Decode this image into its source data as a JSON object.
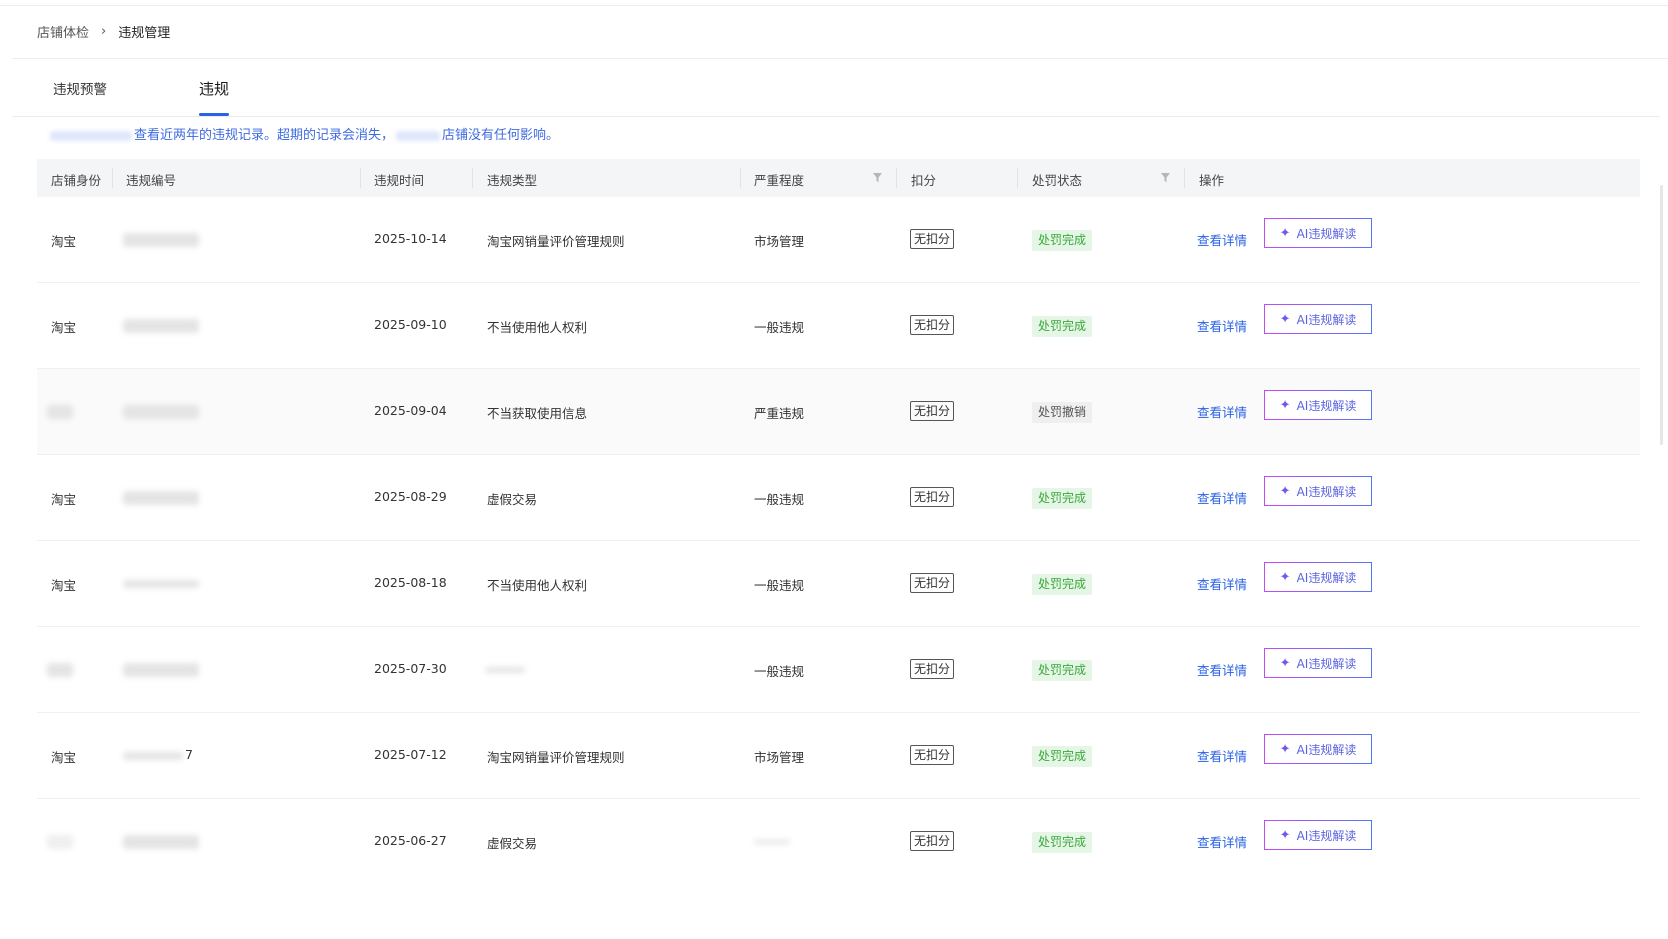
{
  "breadcrumb": {
    "parent": "店铺体检",
    "separator": "›",
    "current": "违规管理"
  },
  "tabs": [
    {
      "label": "违规预警",
      "active": false
    },
    {
      "label": "违规",
      "active": true
    }
  ],
  "notice": {
    "text_1": "查看近两年的违规记录。超期的记录会消失，",
    "text_2": "店铺没有任何影响。"
  },
  "columns": {
    "shop_identity": "店铺身份",
    "violation_id": "违规编号",
    "violation_time": "违规时间",
    "violation_type": "违规类型",
    "severity": "严重程度",
    "deduction": "扣分",
    "penalty_status": "处罚状态",
    "actions": "操作"
  },
  "rows": [
    {
      "shop": "淘宝",
      "id_suffix": "",
      "date": "2025-10-14",
      "type": "淘宝网销量评价管理规则",
      "severity": "市场管理",
      "deduction": "无扣分",
      "status": "处罚完成",
      "status_kind": "done",
      "detail": "查看详情",
      "ai": "AI违规解读"
    },
    {
      "shop": "淘宝",
      "id_suffix": "",
      "date": "2025-09-10",
      "type": "不当使用他人权利",
      "severity": "一般违规",
      "deduction": "无扣分",
      "status": "处罚完成",
      "status_kind": "done",
      "detail": "查看详情",
      "ai": "AI违规解读"
    },
    {
      "shop": "",
      "id_suffix": "",
      "date": "2025-09-04",
      "type": "不当获取使用信息",
      "severity": "严重违规",
      "deduction": "无扣分",
      "status": "处罚撤销",
      "status_kind": "revoked",
      "detail": "查看详情",
      "ai": "AI违规解读"
    },
    {
      "shop": "淘宝",
      "id_suffix": "",
      "date": "2025-08-29",
      "type": "虚假交易",
      "severity": "一般违规",
      "deduction": "无扣分",
      "status": "处罚完成",
      "status_kind": "done",
      "detail": "查看详情",
      "ai": "AI违规解读"
    },
    {
      "shop": "淘宝",
      "id_suffix": "",
      "date": "2025-08-18",
      "type": "不当使用他人权利",
      "severity": "一般违规",
      "deduction": "无扣分",
      "status": "处罚完成",
      "status_kind": "done",
      "detail": "查看详情",
      "ai": "AI违规解读"
    },
    {
      "shop": "",
      "id_suffix": "",
      "date": "2025-07-30",
      "type": "",
      "severity": "一般违规",
      "deduction": "无扣分",
      "status": "处罚完成",
      "status_kind": "done",
      "detail": "查看详情",
      "ai": "AI违规解读"
    },
    {
      "shop": "淘宝",
      "id_suffix": "7",
      "date": "2025-07-12",
      "type": "淘宝网销量评价管理规则",
      "severity": "市场管理",
      "deduction": "无扣分",
      "status": "处罚完成",
      "status_kind": "done",
      "detail": "查看详情",
      "ai": "AI违规解读"
    },
    {
      "shop": "",
      "id_suffix": "",
      "date": "2025-06-27",
      "type": "虚假交易",
      "severity": "",
      "deduction": "无扣分",
      "status": "处罚完成",
      "status_kind": "done",
      "detail": "查看详情",
      "ai": "AI违规解读"
    }
  ],
  "colors": {
    "accent": "#2a62e6",
    "status_done_bg": "#e6f6e6",
    "status_done_text": "#3aa83a",
    "status_revoked_bg": "#efefef",
    "ai_gradient_start": "#c54bf2",
    "ai_gradient_end": "#5577f5"
  },
  "icons": {
    "filter": "filter-funnel-icon",
    "ai": "sparkle-icon"
  }
}
